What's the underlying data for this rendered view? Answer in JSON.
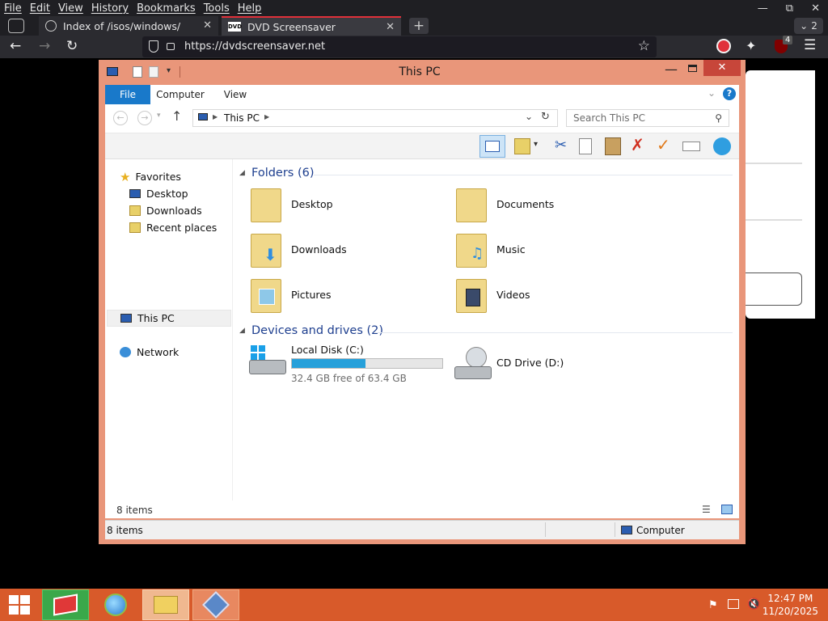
{
  "browser": {
    "menu": [
      "File",
      "Edit",
      "View",
      "History",
      "Bookmarks",
      "Tools",
      "Help"
    ],
    "tabs": [
      {
        "title": "Index of /isos/windows/",
        "active": false
      },
      {
        "title": "DVD Screensaver",
        "active": true
      }
    ],
    "tab_count": "2",
    "url": "https://dvdscreensaver.net",
    "extension_badge": "4",
    "accent_color": "#e0303a"
  },
  "explorer": {
    "title": "This PC",
    "ribbon_tabs": [
      "File",
      "Computer",
      "View"
    ],
    "breadcrumb": "This PC",
    "search_placeholder": "Search This PC",
    "nav": {
      "favorites": "Favorites",
      "favorites_items": [
        "Desktop",
        "Downloads",
        "Recent places"
      ],
      "this_pc": "This PC",
      "network": "Network"
    },
    "folders_header": "Folders (6)",
    "folders": [
      "Desktop",
      "Documents",
      "Downloads",
      "Music",
      "Pictures",
      "Videos"
    ],
    "devices_header": "Devices and drives (2)",
    "drives": [
      {
        "name": "Local Disk (C:)",
        "free_text": "32.4 GB free of 63.4 GB",
        "used_fraction": 0.49
      },
      {
        "name": "CD Drive (D:)"
      }
    ],
    "item_count": "8 items",
    "status_items": "8 items",
    "status_location": "Computer",
    "accent_color": "#1979ca",
    "frame_color": "#e9967a"
  },
  "taskbar": {
    "time": "12:47 PM",
    "date": "11/20/2025",
    "color": "#d85a2a"
  }
}
